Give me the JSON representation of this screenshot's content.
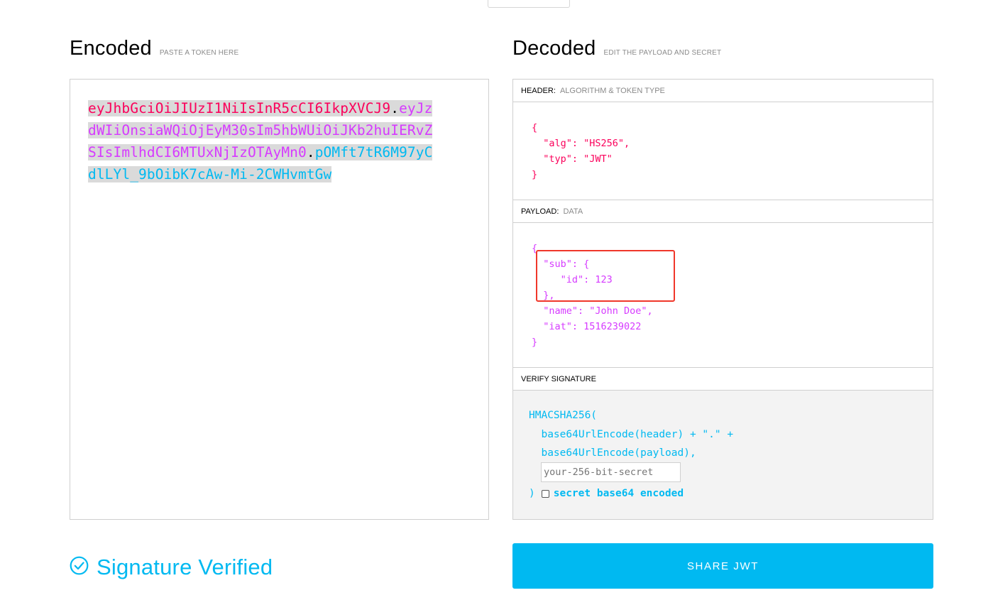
{
  "encoded": {
    "title": "Encoded",
    "subtitle": "PASTE A TOKEN HERE",
    "token": {
      "header": "eyJhbGciOiJIUzI1NiIsInR5cCI6IkpXVCJ9",
      "payload": "eyJzdWIiOnsiaWQiOjEyM30sIm5hbWUiOiJKb2huIERvZSIsImlhdCI6MTUxNjIzOTAyMn0",
      "signature": "pOMft7tR6M97yCdlLYl_9bOibK7cAw-Mi-2CWHvmtGw",
      "dot": "."
    }
  },
  "decoded": {
    "title": "Decoded",
    "subtitle": "EDIT THE PAYLOAD AND SECRET",
    "header_section": {
      "label": "HEADER:",
      "sublabel": "ALGORITHM & TOKEN TYPE",
      "json": "{\n  \"alg\": \"HS256\",\n  \"typ\": \"JWT\"\n}"
    },
    "payload_section": {
      "label": "PAYLOAD:",
      "sublabel": "DATA",
      "json": "{\n  \"sub\": {\n     \"id\": 123\n  },\n  \"name\": \"John Doe\",\n  \"iat\": 1516239022\n}"
    },
    "verify_section": {
      "label": "VERIFY SIGNATURE",
      "code": "HMACSHA256(\n  base64UrlEncode(header) + \".\" +\n  base64UrlEncode(payload),",
      "secret_placeholder": "your-256-bit-secret",
      "closing": ")",
      "checkbox_label": "secret base64 encoded",
      "checkbox_checked": false
    }
  },
  "status": {
    "icon": "check-circle-icon",
    "text": "Signature Verified"
  },
  "share_button": {
    "label": "SHARE JWT"
  },
  "colors": {
    "header": "#fb015b",
    "payload": "#d63aff",
    "signature": "#00b9f1",
    "highlight": "#f0372a"
  }
}
